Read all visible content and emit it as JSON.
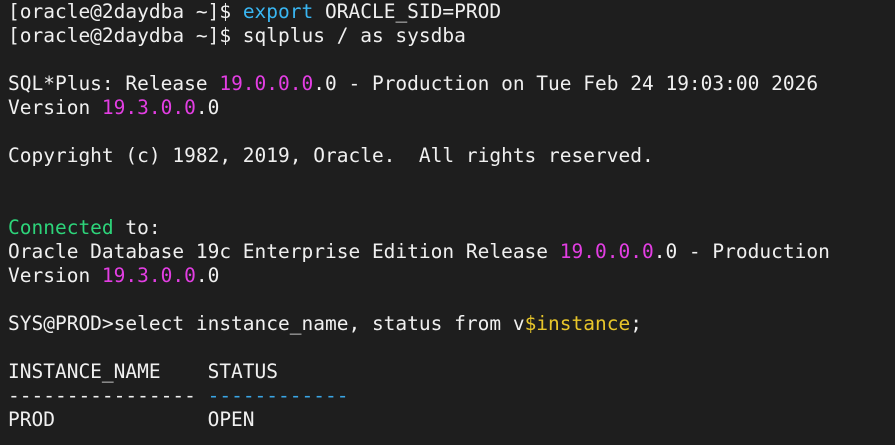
{
  "terminal": {
    "lines": [
      {
        "parts": [
          {
            "text": "[oracle@2daydba ~]$ ",
            "color": "white"
          },
          {
            "text": "export",
            "color": "cyan"
          },
          {
            "text": " ORACLE_SID=PROD",
            "color": "white"
          }
        ]
      },
      {
        "parts": [
          {
            "text": "[oracle@2daydba ~]$ sqlplus / as sysdba",
            "color": "white"
          }
        ]
      },
      {
        "parts": []
      },
      {
        "parts": [
          {
            "text": "SQL*Plus: Release ",
            "color": "white"
          },
          {
            "text": "19.0.0.0",
            "color": "magenta"
          },
          {
            "text": ".0 - Production on Tue Feb 24 19:03:00 2026",
            "color": "white"
          }
        ]
      },
      {
        "parts": [
          {
            "text": "Version ",
            "color": "white"
          },
          {
            "text": "19.3.0.0",
            "color": "magenta"
          },
          {
            "text": ".0",
            "color": "white"
          }
        ]
      },
      {
        "parts": []
      },
      {
        "parts": [
          {
            "text": "Copyright (c) 1982, 2019, Oracle.  All rights reserved.",
            "color": "white"
          }
        ]
      },
      {
        "parts": []
      },
      {
        "parts": []
      },
      {
        "parts": [
          {
            "text": "Connected",
            "color": "green"
          },
          {
            "text": " to:",
            "color": "white"
          }
        ]
      },
      {
        "parts": [
          {
            "text": "Oracle Database 19c Enterprise Edition Release ",
            "color": "white"
          },
          {
            "text": "19.0.0.0",
            "color": "magenta"
          },
          {
            "text": ".0 - Production",
            "color": "white"
          }
        ]
      },
      {
        "parts": [
          {
            "text": "Version ",
            "color": "white"
          },
          {
            "text": "19.3.0.0",
            "color": "magenta"
          },
          {
            "text": ".0",
            "color": "white"
          }
        ]
      },
      {
        "parts": []
      },
      {
        "parts": [
          {
            "text": "SYS@PROD>select instance_name, status from v",
            "color": "white"
          },
          {
            "text": "$instance",
            "color": "yellow"
          },
          {
            "text": ";",
            "color": "white"
          }
        ]
      },
      {
        "parts": []
      },
      {
        "parts": [
          {
            "text": "INSTANCE_NAME    STATUS",
            "color": "white"
          }
        ]
      },
      {
        "parts": [
          {
            "text": "---------------- ",
            "color": "white"
          },
          {
            "text": "------------",
            "color": "bluedash"
          }
        ]
      },
      {
        "parts": [
          {
            "text": "PROD             OPEN",
            "color": "white"
          }
        ]
      }
    ]
  },
  "colors": {
    "background": "#1e1e1e",
    "white": "#f0f0f0",
    "cyan": "#39b6f2",
    "magenta": "#e33ee3",
    "green": "#2dd47a",
    "yellow": "#e8c62a",
    "bluedash": "#39a6e6"
  }
}
